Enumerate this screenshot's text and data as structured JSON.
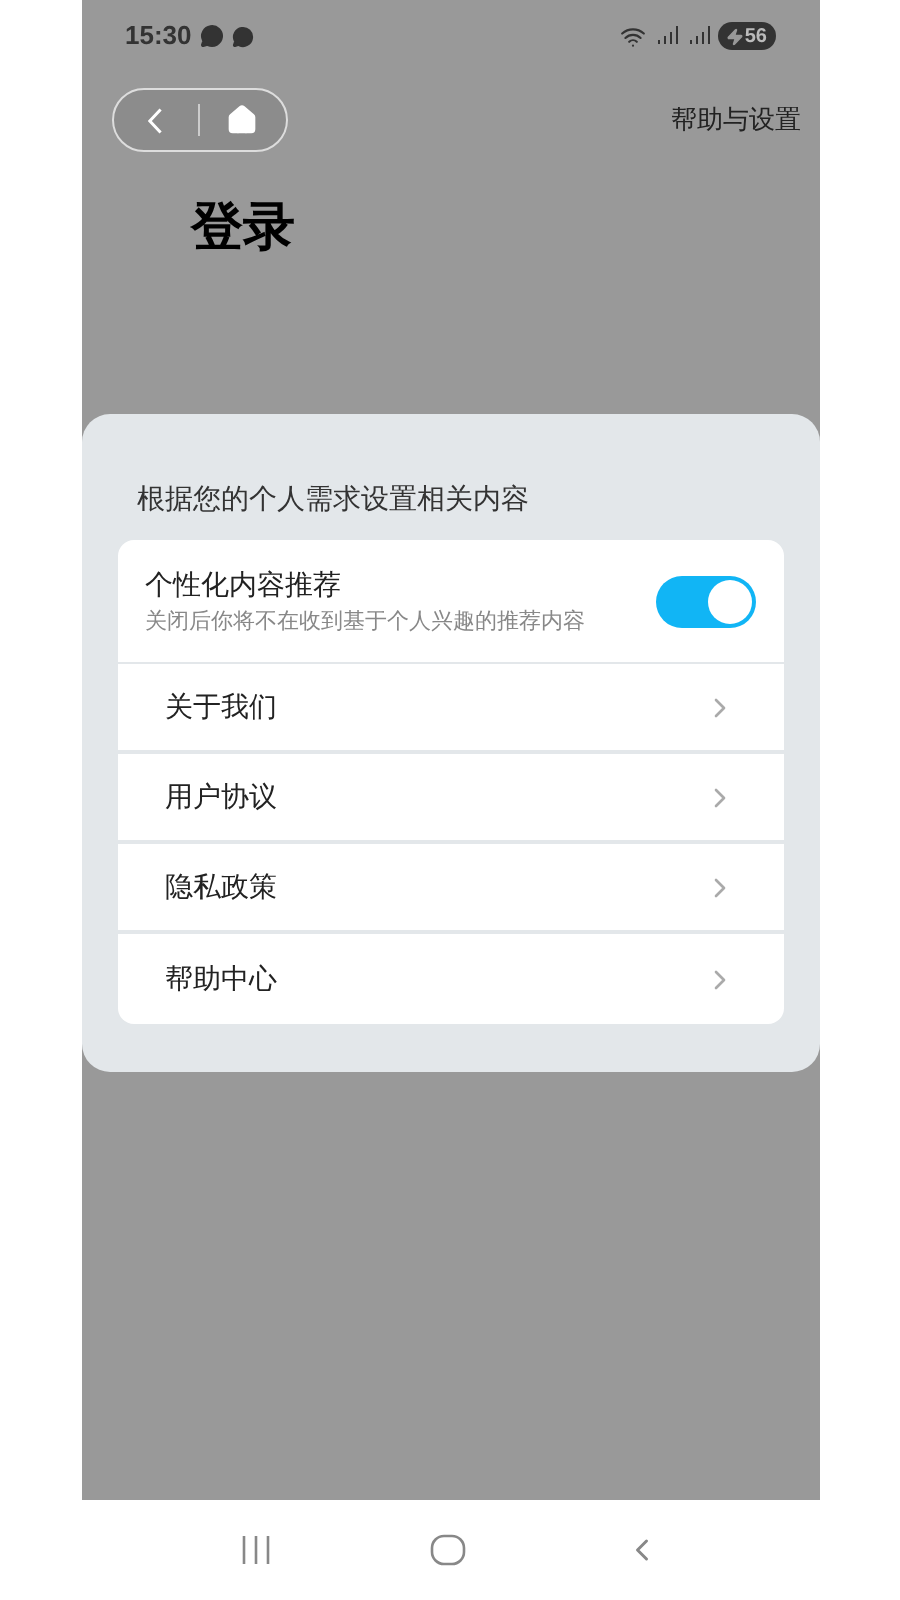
{
  "status_bar": {
    "time": "15:30",
    "battery": "56"
  },
  "header": {
    "help_link": "帮助与设置",
    "title": "登录"
  },
  "sheet": {
    "caption": "根据您的个人需求设置相关内容",
    "toggle": {
      "label": "个性化内容推荐",
      "description": "关闭后你将不在收到基于个人兴趣的推荐内容",
      "on": true
    },
    "items": [
      {
        "label": "关于我们"
      },
      {
        "label": "用户协议"
      },
      {
        "label": "隐私政策"
      },
      {
        "label": "帮助中心"
      }
    ]
  }
}
